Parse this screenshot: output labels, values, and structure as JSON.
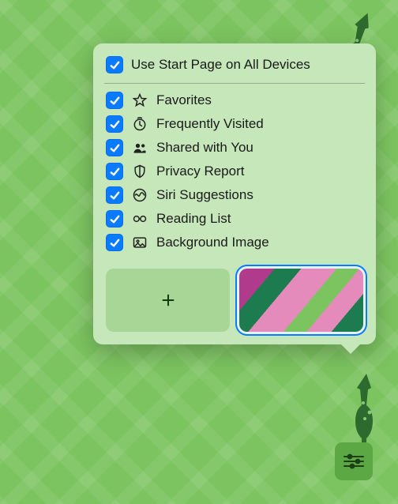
{
  "popover": {
    "header": {
      "checked": true,
      "label": "Use Start Page on All Devices"
    },
    "items": [
      {
        "checked": true,
        "icon": "star-icon",
        "label": "Favorites"
      },
      {
        "checked": true,
        "icon": "clock-icon",
        "label": "Frequently Visited"
      },
      {
        "checked": true,
        "icon": "people-icon",
        "label": "Shared with You"
      },
      {
        "checked": true,
        "icon": "shield-icon",
        "label": "Privacy Report"
      },
      {
        "checked": true,
        "icon": "siri-icon",
        "label": "Siri Suggestions"
      },
      {
        "checked": true,
        "icon": "glasses-icon",
        "label": "Reading List"
      },
      {
        "checked": true,
        "icon": "image-icon",
        "label": "Background Image"
      }
    ],
    "thumbnails": {
      "add": {
        "name": "add-background-button"
      },
      "selected": {
        "name": "current-background-thumbnail"
      }
    }
  },
  "settingsButton": {
    "name": "settings-icon"
  }
}
